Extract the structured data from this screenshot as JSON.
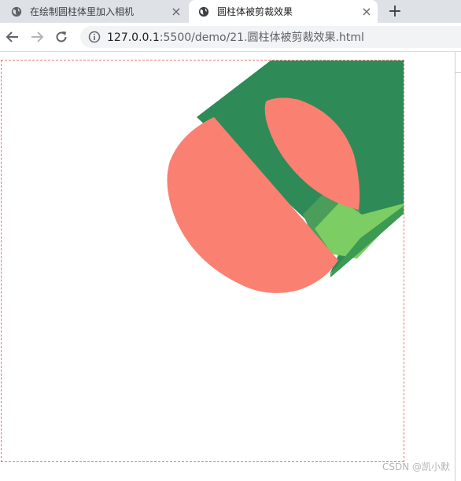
{
  "tabs": [
    {
      "title": "在绘制圆柱体里加入相机",
      "icon": "globe-icon",
      "close_label": "×",
      "active": false
    },
    {
      "title": "圆柱体被剪裁效果",
      "icon": "globe-icon",
      "close_label": "×",
      "active": true
    }
  ],
  "new_tab_label": "+",
  "toolbar": {
    "back_icon": "back-arrow-icon",
    "forward_icon": "forward-arrow-icon",
    "reload_icon": "reload-icon",
    "site_info_icon": "info-icon"
  },
  "address": {
    "host": "127.0.0.1",
    "rest": ":5500/demo/21.圆柱体被剪裁效果.html"
  },
  "scene": {
    "cylinder_body_color": "#2e8b57",
    "cylinder_highlight_color": "#7ccd63",
    "cap_color": "#fa8072",
    "canvas_border_color": "#e07b6f"
  },
  "watermark": "CSDN @凯小默"
}
